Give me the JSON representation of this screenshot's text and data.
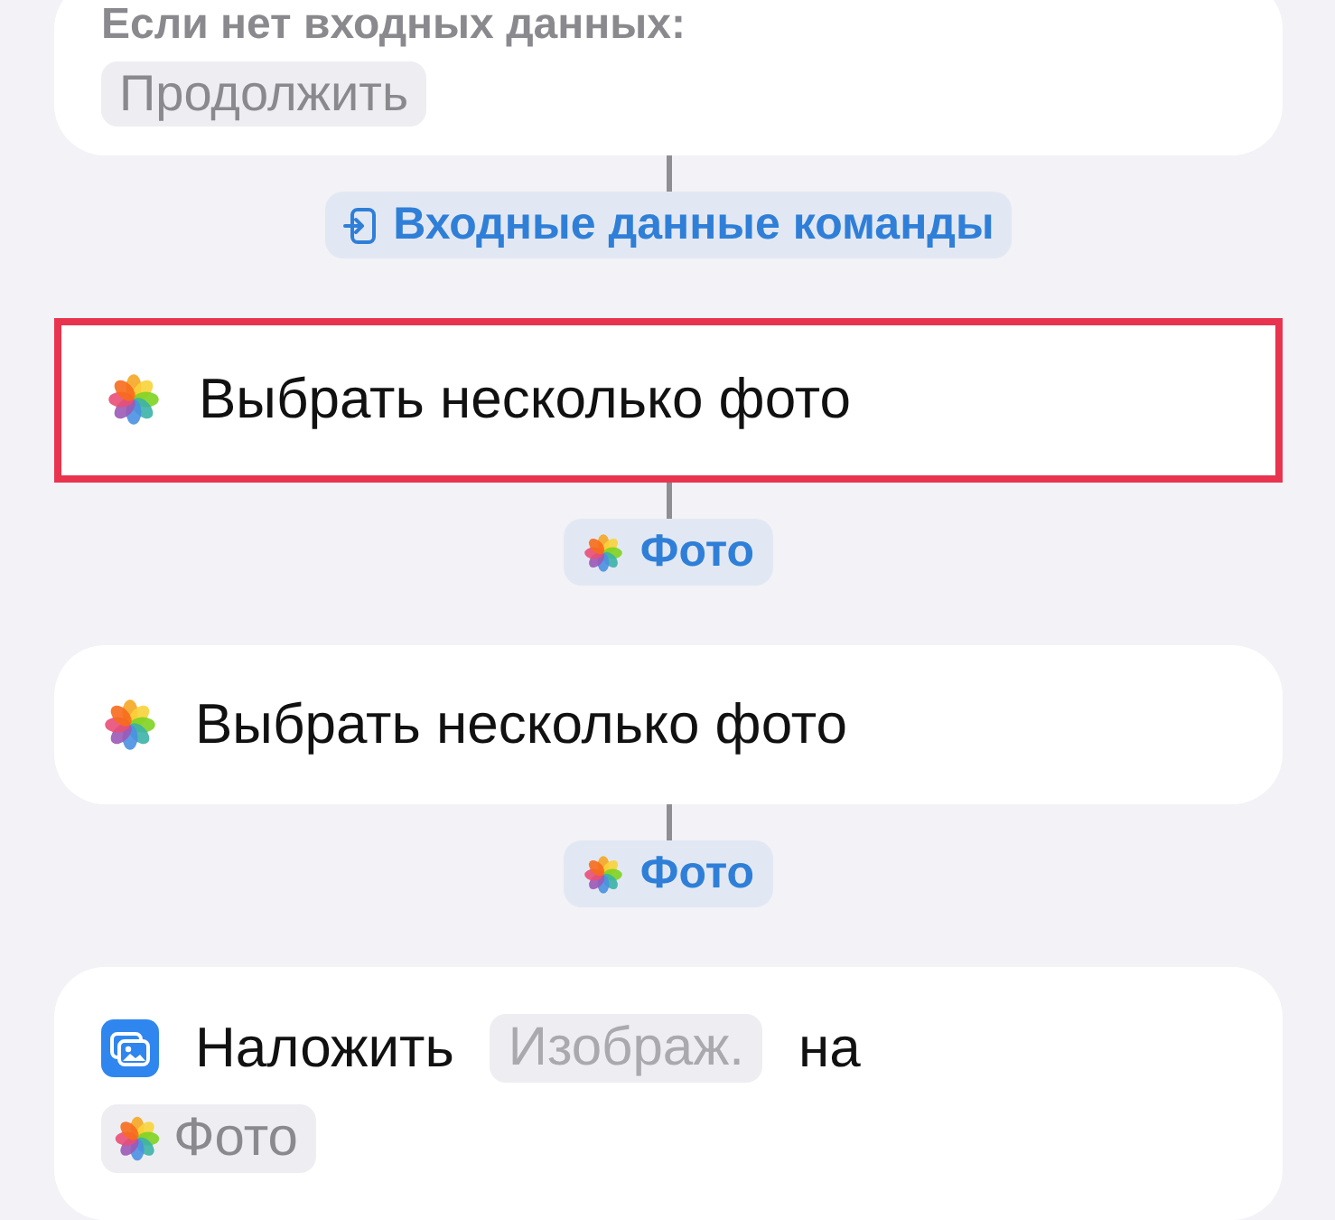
{
  "top_card": {
    "label": "Если нет входных данных:",
    "token": "Продолжить"
  },
  "flow": [
    {
      "kind": "input-variable",
      "label": "Входные данные команды"
    },
    {
      "kind": "photos-action",
      "highlighted": true,
      "parts": [
        {
          "kind": "text",
          "text": "Выбрать несколько фото"
        }
      ]
    },
    {
      "kind": "photos-variable",
      "label": "Фото"
    },
    {
      "kind": "photos-action",
      "highlighted": false,
      "parts": [
        {
          "kind": "text",
          "text": "Выбрать несколько фото"
        }
      ]
    },
    {
      "kind": "photos-variable",
      "label": "Фото"
    },
    {
      "kind": "overlay-action",
      "highlighted": false,
      "parts": [
        {
          "kind": "text",
          "text": "Наложить"
        },
        {
          "kind": "placeholder",
          "text": "Изображ."
        },
        {
          "kind": "text",
          "text": "на"
        },
        {
          "kind": "photo-token",
          "text": "Фото"
        }
      ]
    }
  ]
}
